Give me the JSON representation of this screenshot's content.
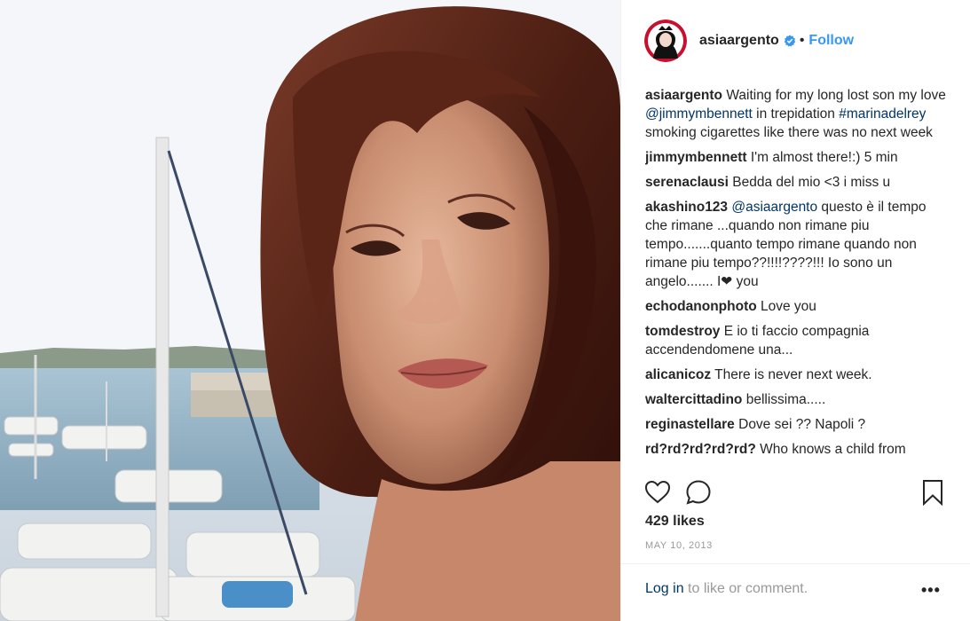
{
  "post": {
    "username": "asiaargento",
    "follow_label": "Follow",
    "separator": "•",
    "verified_icon": "verified-badge-icon",
    "caption": {
      "user": "asiaargento",
      "text_1": " Waiting for my long lost son my love ",
      "mention": "@jimmymbennett",
      "text_2": " in trepidation ",
      "hashtag": "#marinadelrey",
      "text_3": " smoking cigarettes like there was no next week"
    },
    "comments": [
      {
        "user": "jimmymbennett",
        "text": " I'm almost there!:) 5 min"
      },
      {
        "user": "serenaclausi",
        "text": " Bedda del mio <3 i miss u"
      },
      {
        "user": "akashino123",
        "mention": "@asiaargento",
        "text": " questo è il tempo che rimane ...quando non rimane piu tempo.......quanto tempo rimane quando non rimane piu tempo??!!!!????!!! Io sono un angelo....... I❤ you"
      },
      {
        "user": "echodanonphoto",
        "text": " Love you"
      },
      {
        "user": "tomdestroy",
        "text": " E io ti faccio compagnia accendendomene una..."
      },
      {
        "user": "alicanicoz",
        "text": " There is never next week."
      },
      {
        "user": "waltercittadino",
        "text": " bellissima....."
      },
      {
        "user": "reginastellare",
        "text": " Dove sei ?? Napoli ?"
      },
      {
        "user": "rd?rd?rd?rd?rd?",
        "text": " Who knows a child from"
      }
    ],
    "likes": "429 likes",
    "date": "MAY 10, 2013",
    "login_link": "Log in",
    "login_text": " to like or comment.",
    "more_label": "•••",
    "icons": {
      "like": "heart-icon",
      "comment": "comment-bubble-icon",
      "save": "bookmark-icon",
      "more": "more-options-icon"
    },
    "colors": {
      "link_blue": "#3897f0",
      "mention_navy": "#003569",
      "muted_gray": "#999999"
    }
  }
}
